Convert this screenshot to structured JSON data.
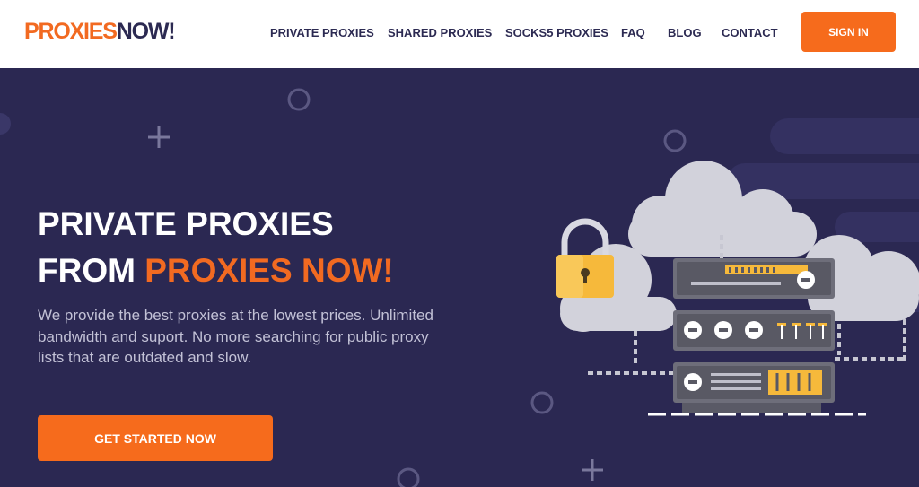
{
  "brand": {
    "part1": "PROXIES",
    "part2": "NOW!"
  },
  "nav": {
    "items": [
      {
        "label": "PRIVATE PROXIES"
      },
      {
        "label": "SHARED PROXIES"
      },
      {
        "label": "SOCKS5 PROXIES"
      },
      {
        "label": "FAQ"
      },
      {
        "label": "BLOG"
      },
      {
        "label": "CONTACT"
      }
    ],
    "signin": "SIGN IN"
  },
  "hero": {
    "title_line1": "PRIVATE PROXIES",
    "title_line2_prefix": "FROM ",
    "title_line2_highlight": "PROXIES NOW!",
    "description": "We provide the best proxies at the lowest prices. Unlimited bandwidth and suport. No more searching for public proxy lists that are outdated and slow.",
    "cta": "GET STARTED NOW"
  },
  "colors": {
    "accent": "#f66b1c",
    "brand_orange": "#f26a21",
    "navy": "#2b2852",
    "text_dark": "#2c2a52"
  },
  "illustration": {
    "icons": [
      "cloud-icon",
      "padlock-icon",
      "server-rack-icon",
      "plus-decoration",
      "circle-decoration"
    ]
  }
}
